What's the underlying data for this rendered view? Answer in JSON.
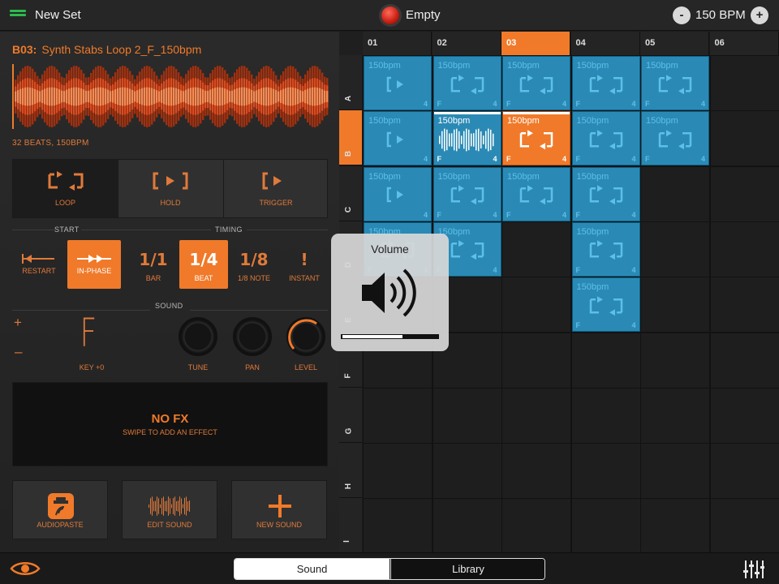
{
  "topbar": {
    "set_title": "New Set",
    "song_title": "Empty",
    "bpm": "150 BPM",
    "minus": "-",
    "plus": "+"
  },
  "clip": {
    "slot": "B03:",
    "name": "Synth Stabs Loop 2_F_150bpm",
    "beats": "32 BEATS, 150BPM"
  },
  "modes": [
    {
      "label": "LOOP",
      "active": true
    },
    {
      "label": "HOLD",
      "active": false
    },
    {
      "label": "TRIGGER",
      "active": false
    }
  ],
  "sections": {
    "start": "START",
    "timing": "TIMING",
    "sound": "SOUND"
  },
  "start_options": [
    {
      "label": "RESTART"
    },
    {
      "label": "IN-PHASE",
      "active": true
    }
  ],
  "timing_options": [
    {
      "label": "BAR",
      "icon": "1/1"
    },
    {
      "label": "BEAT",
      "icon": "1/4",
      "active": true
    },
    {
      "label": "1/8 NOTE",
      "icon": "1/8"
    },
    {
      "label": "INSTANT",
      "icon": "!"
    }
  ],
  "sound": {
    "plus": "+",
    "minus": "–",
    "key_glyph": "F",
    "key": "KEY +0",
    "tune": "TUNE",
    "pan": "PAN",
    "level": "LEVEL"
  },
  "fx": {
    "title": "NO FX",
    "hint": "SWIPE TO ADD AN EFFECT"
  },
  "bottom_buttons": {
    "audiopaste": "AUDIOPASTE",
    "edit": "EDIT SOUND",
    "new": "NEW SOUND"
  },
  "grid": {
    "columns": [
      "01",
      "02",
      "03",
      "04",
      "05",
      "06"
    ],
    "selected_column": "03",
    "rows": [
      "A",
      "B",
      "C",
      "D",
      "E",
      "F",
      "G",
      "H",
      "I"
    ],
    "selected_row": "B",
    "clip_label": "150bpm",
    "clip_key": "F",
    "clip_quant": "4"
  },
  "volume_hud": {
    "title": "Volume",
    "level_ticks": 16
  },
  "tabs": {
    "sound": "Sound",
    "library": "Library"
  },
  "colors": {
    "accent": "#f07a2a",
    "clip": "#2a8ab5",
    "record": "#e0281a",
    "menu": "#2dbb4e"
  }
}
